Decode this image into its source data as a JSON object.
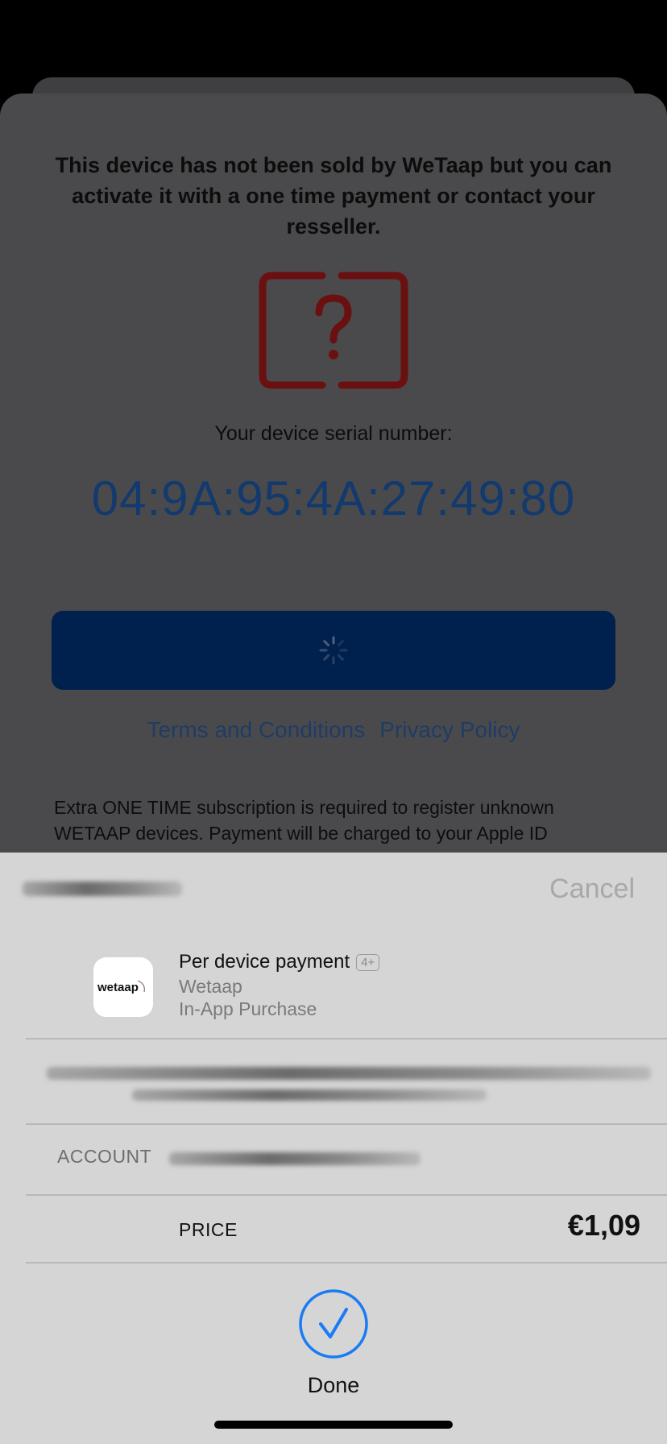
{
  "activation": {
    "message": "This device has not been sold by WeTaap but you can activate it with a one time payment or contact your resseller.",
    "unknown_device_icon": "question-mark-frame-icon",
    "serial_label": "Your device serial number:",
    "serial_value": "04:9A:95:4A:27:49:80",
    "button_state_icon": "spinner-icon",
    "terms_link": "Terms and Conditions",
    "privacy_link": "Privacy Policy",
    "footer_text": "Extra ONE TIME subscription is required to register unknown WETAAP devices. Payment will be charged to your Apple ID"
  },
  "payment_sheet": {
    "cancel_label": "Cancel",
    "app_icon_text": "wetaap",
    "product_name": "Per device payment",
    "age_rating": "4+",
    "vendor": "Wetaap",
    "purchase_type": "In-App Purchase",
    "account_label": "ACCOUNT",
    "price_label": "PRICE",
    "price_value": "€1,09",
    "done_icon": "checkmark-circle-icon",
    "done_label": "Done"
  },
  "colors": {
    "accent_blue": "#1a7cf5",
    "serial_blue": "#123a6e",
    "button_navy": "#00204d",
    "icon_red": "#6b1010"
  }
}
